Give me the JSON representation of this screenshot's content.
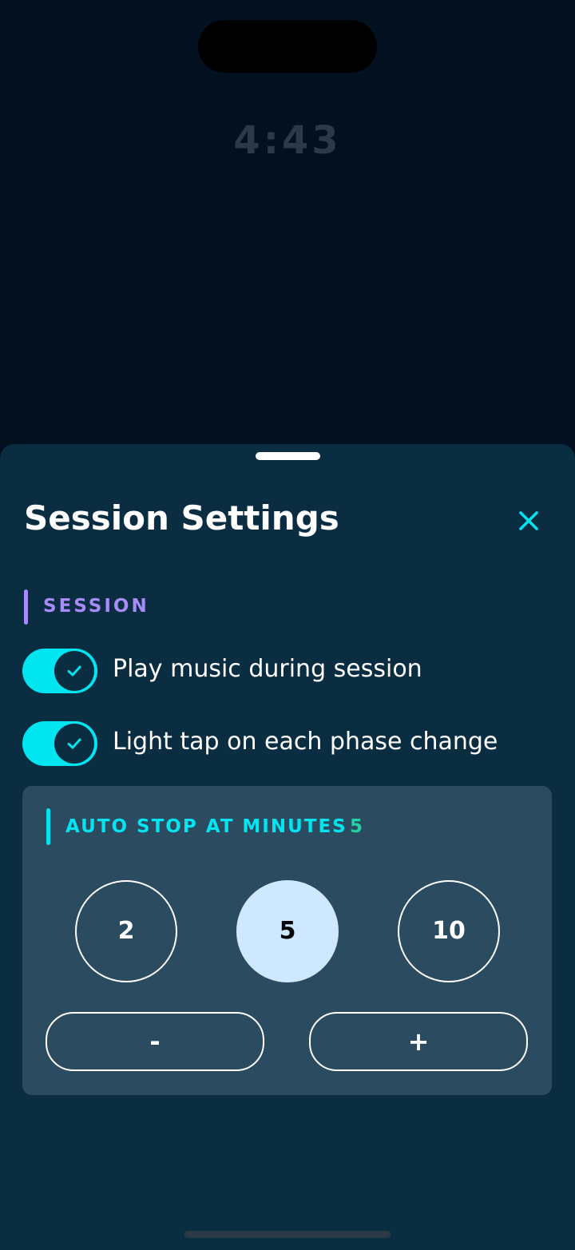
{
  "status": {
    "timer": "4:43"
  },
  "sheet": {
    "title": "Session Settings",
    "close_icon": "close-icon"
  },
  "session": {
    "section_label": "SESSION",
    "toggles": [
      {
        "label": "Play music during session",
        "on": true
      },
      {
        "label": "Light tap on each phase change",
        "on": true
      }
    ]
  },
  "auto_stop": {
    "label": "AUTO STOP AT MINUTES",
    "value": "5",
    "presets": [
      "2",
      "5",
      "10"
    ],
    "selected": "5",
    "decrement_label": "-",
    "increment_label": "+"
  },
  "colors": {
    "accent": "#00e5f0",
    "section": "#a78bfa",
    "value": "#22d3a5",
    "sheet_bg": "#0a2d42",
    "card_bg": "#2b4b61",
    "selected_preset": "#cde8ff"
  }
}
